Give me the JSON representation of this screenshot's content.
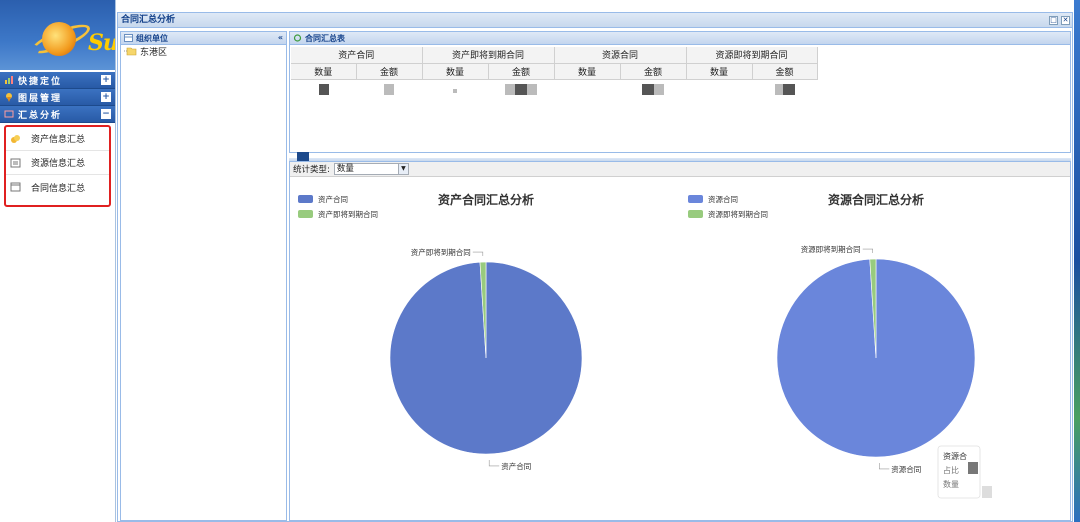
{
  "app": {
    "logo_text": "Su"
  },
  "sidebar": {
    "groups": [
      {
        "label": "快捷定位",
        "toggle": "+"
      },
      {
        "label": "图层管理",
        "toggle": "+"
      },
      {
        "label": "汇总分析",
        "toggle": "−"
      }
    ],
    "items": [
      {
        "label": "资产信息汇总"
      },
      {
        "label": "资源信息汇总"
      },
      {
        "label": "合同信息汇总"
      }
    ]
  },
  "window": {
    "title": "合同汇总分析"
  },
  "org_panel": {
    "title": "组织单位",
    "tree": [
      "东港区"
    ]
  },
  "summary": {
    "title": "合同汇总表",
    "groups": [
      "资产合同",
      "资产即将到期合同",
      "资源合同",
      "资源即将到期合同"
    ],
    "subcolumns": [
      "数量",
      "金额"
    ]
  },
  "chart_panel": {
    "type_label": "统计类型:",
    "type_value": "数量"
  },
  "colors": {
    "primary_blue": "#5c79c9",
    "secondary_green": "#98cb7e",
    "header_blue": "#285aa6"
  },
  "chart_data": [
    {
      "type": "pie",
      "title": "资产合同汇总分析",
      "legend": [
        "资产合同",
        "资产即将到期合同"
      ],
      "legend_position": "top-left",
      "slices": [
        {
          "label": "资产合同",
          "value": 99,
          "color": "#5c79c9"
        },
        {
          "label": "资产即将到期合同",
          "value": 1,
          "color": "#98cb7e"
        }
      ]
    },
    {
      "type": "pie",
      "title": "资源合同汇总分析",
      "legend": [
        "资源合同",
        "资源即将到期合同"
      ],
      "legend_position": "top-left",
      "slices": [
        {
          "label": "资源合同",
          "value": 99,
          "color": "#6a86db"
        },
        {
          "label": "资源即将到期合同",
          "value": 1,
          "color": "#98cb7e"
        }
      ],
      "tooltip": {
        "lines": [
          "资源合",
          "占比",
          "数量"
        ]
      }
    }
  ]
}
